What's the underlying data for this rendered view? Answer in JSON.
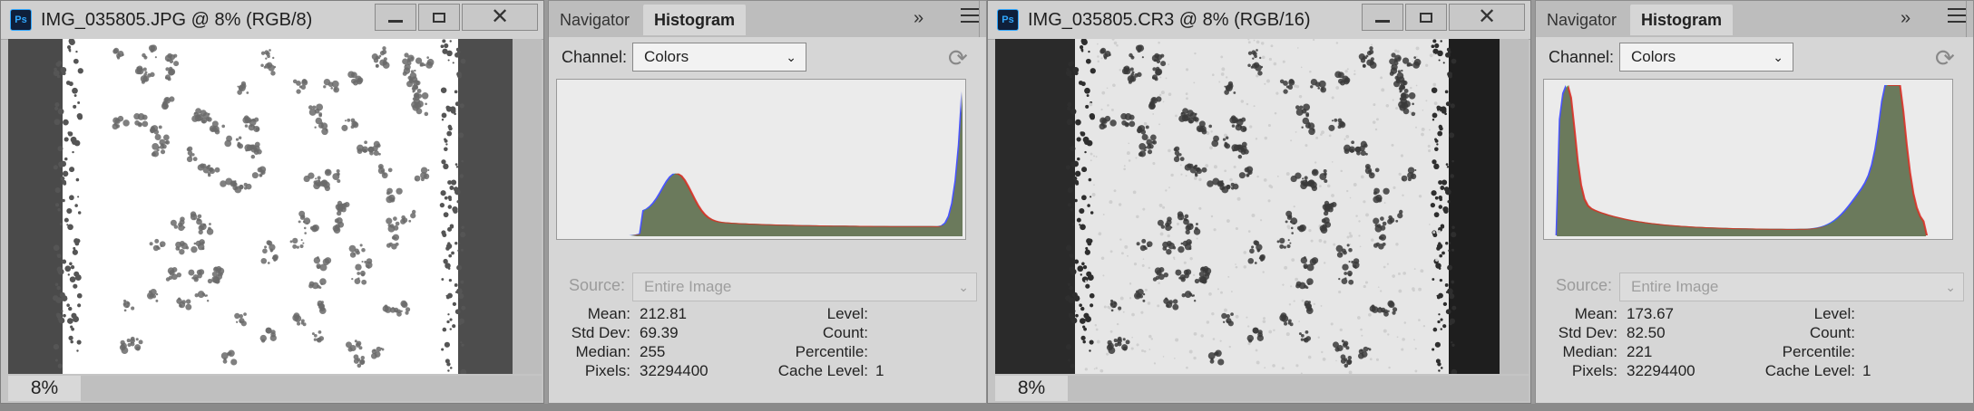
{
  "left": {
    "doc_title": "IMG_035805.JPG @ 8% (RGB/8)",
    "zoom": "8%",
    "histogram": {
      "tabs": [
        "Navigator",
        "Histogram"
      ],
      "channel_label": "Channel:",
      "channel_value": "Colors",
      "source_label": "Source:",
      "source_value": "Entire Image",
      "stats": {
        "mean_label": "Mean:",
        "mean": "212.81",
        "stddev_label": "Std Dev:",
        "stddev": "69.39",
        "median_label": "Median:",
        "median": "255",
        "pixels_label": "Pixels:",
        "pixels": "32294400",
        "level_label": "Level:",
        "level": "",
        "count_label": "Count:",
        "count": "",
        "percentile_label": "Percentile:",
        "percentile": "",
        "cache_label": "Cache Level:",
        "cache": "1"
      }
    }
  },
  "right": {
    "doc_title": "IMG_035805.CR3 @ 8% (RGB/16)",
    "zoom": "8%",
    "histogram": {
      "tabs": [
        "Navigator",
        "Histogram"
      ],
      "channel_label": "Channel:",
      "channel_value": "Colors",
      "source_label": "Source:",
      "source_value": "Entire Image",
      "stats": {
        "mean_label": "Mean:",
        "mean": "173.67",
        "stddev_label": "Std Dev:",
        "stddev": "82.50",
        "median_label": "Median:",
        "median": "221",
        "pixels_label": "Pixels:",
        "pixels": "32294400",
        "level_label": "Level:",
        "level": "",
        "count_label": "Count:",
        "count": "",
        "percentile_label": "Percentile:",
        "percentile": "",
        "cache_label": "Cache Level:",
        "cache": "1"
      }
    }
  },
  "icons": {
    "app": "photoshop-icon",
    "minimize": "minimize-icon",
    "maximize": "maximize-icon",
    "close": "close-icon",
    "collapse": "double-chevron-right-icon",
    "menu": "panel-menu-icon",
    "refresh": "refresh-icon",
    "dropdown": "chevron-down-icon"
  },
  "colors": {
    "histogram_fill": "#6b7a5c",
    "histogram_bg": "#ebebeb",
    "ps_blue": "#31a8ff"
  }
}
